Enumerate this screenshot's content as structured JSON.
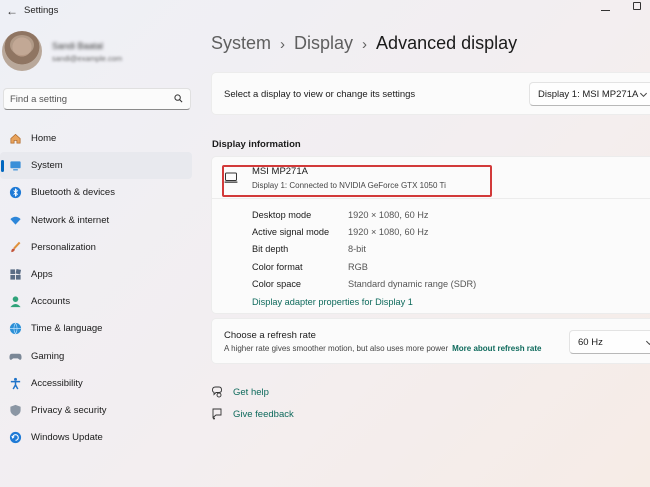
{
  "window": {
    "title": "Settings"
  },
  "profile": {
    "name": "Sandi Baatal",
    "email": "sandi@example.com"
  },
  "search": {
    "placeholder": "Find a setting"
  },
  "sidebar": {
    "items": [
      {
        "label": "Home",
        "icon": "home-icon",
        "active": false
      },
      {
        "label": "System",
        "icon": "system-icon",
        "active": true
      },
      {
        "label": "Bluetooth & devices",
        "icon": "bluetooth-icon",
        "active": false
      },
      {
        "label": "Network & internet",
        "icon": "wifi-icon",
        "active": false
      },
      {
        "label": "Personalization",
        "icon": "brush-icon",
        "active": false
      },
      {
        "label": "Apps",
        "icon": "apps-icon",
        "active": false
      },
      {
        "label": "Accounts",
        "icon": "person-icon",
        "active": false
      },
      {
        "label": "Time & language",
        "icon": "globe-clock-icon",
        "active": false
      },
      {
        "label": "Gaming",
        "icon": "gamepad-icon",
        "active": false
      },
      {
        "label": "Accessibility",
        "icon": "accessibility-icon",
        "active": false
      },
      {
        "label": "Privacy & security",
        "icon": "shield-icon",
        "active": false
      },
      {
        "label": "Windows Update",
        "icon": "update-icon",
        "active": false
      }
    ]
  },
  "breadcrumb": {
    "part1": "System",
    "part2": "Display",
    "current": "Advanced display",
    "separator": "›"
  },
  "display_select": {
    "label": "Select a display to view or change its settings",
    "value": "Display 1: MSI MP271A"
  },
  "display_info": {
    "section_title": "Display information",
    "monitor_name": "MSI MP271A",
    "monitor_subtitle": "Display 1: Connected to NVIDIA GeForce GTX 1050 Ti",
    "properties": [
      {
        "name": "Desktop mode",
        "value": "1920 × 1080, 60 Hz"
      },
      {
        "name": "Active signal mode",
        "value": "1920 × 1080, 60 Hz"
      },
      {
        "name": "Bit depth",
        "value": "8-bit"
      },
      {
        "name": "Color format",
        "value": "RGB"
      },
      {
        "name": "Color space",
        "value": "Standard dynamic range (SDR)"
      }
    ],
    "adapter_link": "Display adapter properties for Display 1"
  },
  "refresh_rate": {
    "title": "Choose a refresh rate",
    "description": "A higher rate gives smoother motion, but also uses more power",
    "more_link": "More about refresh rate",
    "value": "60 Hz"
  },
  "help": {
    "get_help": "Get help",
    "give_feedback": "Give feedback"
  },
  "colors": {
    "accent": "#0067c0",
    "link": "#0e6a5c",
    "highlight_box": "#d23a3a"
  }
}
